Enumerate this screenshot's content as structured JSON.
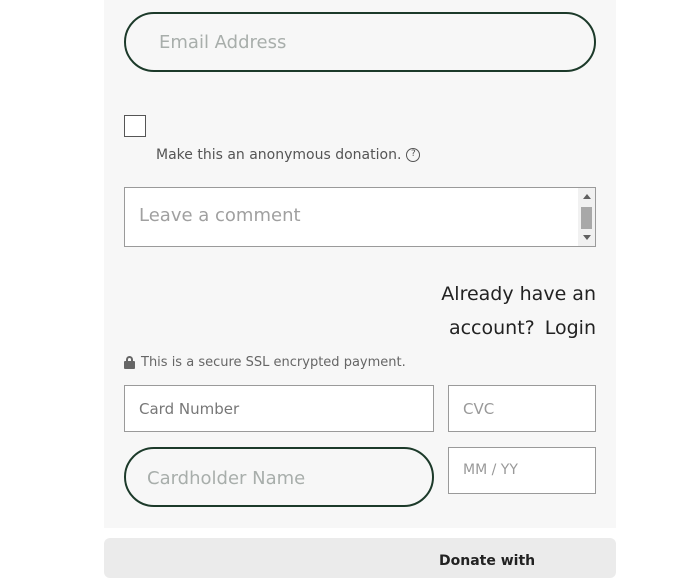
{
  "form": {
    "email_placeholder": "Email Address",
    "anonymous_label": "Make this an anonymous donation.",
    "help_icon": "?",
    "comment_placeholder": "Leave a comment",
    "account_line1": "Already have an",
    "account_line2": "account?",
    "login_label": "Login",
    "ssl_text": "This is a secure SSL encrypted payment.",
    "card_number_placeholder": "Card Number",
    "cvc_placeholder": "CVC",
    "cardholder_placeholder": "Cardholder Name",
    "expiry_placeholder": "MM / YY",
    "donate_label": "Donate with"
  },
  "colors": {
    "accent_border": "#1c3a2a",
    "panel_bg": "#f7f7f7"
  }
}
